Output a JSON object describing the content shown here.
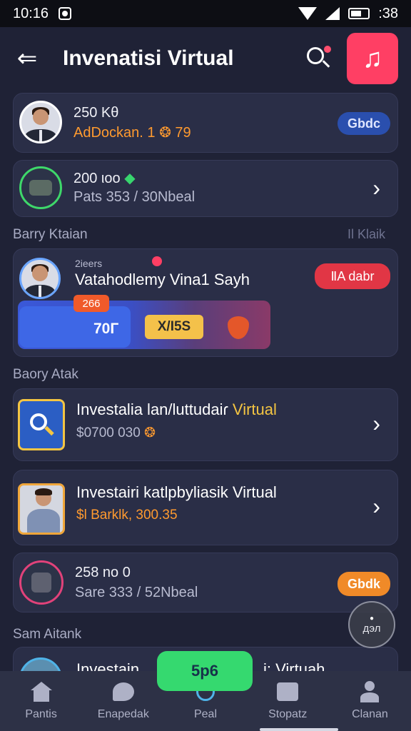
{
  "status_bar": {
    "time": "10:16",
    "battery_text": ":38"
  },
  "header": {
    "title": "Invenatisi Virtual"
  },
  "card1": {
    "line1": "250 Kθ",
    "line2_label": "AdDockan. 1",
    "line2_num": "79",
    "badge": "Gbdc",
    "badge_color": "#2a4fae"
  },
  "card2": {
    "line1": "200 ιοο",
    "line2": "Pats 353 / 30Nbeal"
  },
  "section1": {
    "label": "Barry Ktaian",
    "right": "Il Klaik"
  },
  "card3": {
    "small": "2ieers",
    "title": "Vatahodlemy Vina1 Sayh",
    "badge": "ⅡA dabr",
    "chip_top": "266",
    "block_blue": "70Г",
    "block_yellow": "X/I5S"
  },
  "section2": {
    "label": "Baory Atak"
  },
  "card4": {
    "title_part": "Investalia lan/luttudaiɾ",
    "title_highlight": "Virtual",
    "subtitle": "$0700 030"
  },
  "card5": {
    "title": "Investairi katlpbyliasik Virtual",
    "sub_prefix": "$l",
    "sub_value": "Barklk, 300.35"
  },
  "card6": {
    "line1": "258 no 0",
    "line2": "Sare 333 / 52Nbeal",
    "badge": "Gbdk"
  },
  "section3": {
    "label": "Sam Aitank"
  },
  "card7": {
    "title_left": "Investain",
    "title_right": "i: Virtuah"
  },
  "fab_green": {
    "label": "5p6"
  },
  "fab_round": {
    "label": "дэл"
  },
  "nav": [
    {
      "label": "Pantis",
      "icon": "home-icon"
    },
    {
      "label": "Enapedak",
      "icon": "chat-icon"
    },
    {
      "label": "Peal",
      "icon": "target-icon"
    },
    {
      "label": "Stopatz",
      "icon": "face-icon"
    },
    {
      "label": "Clanan",
      "icon": "profile-icon"
    }
  ]
}
